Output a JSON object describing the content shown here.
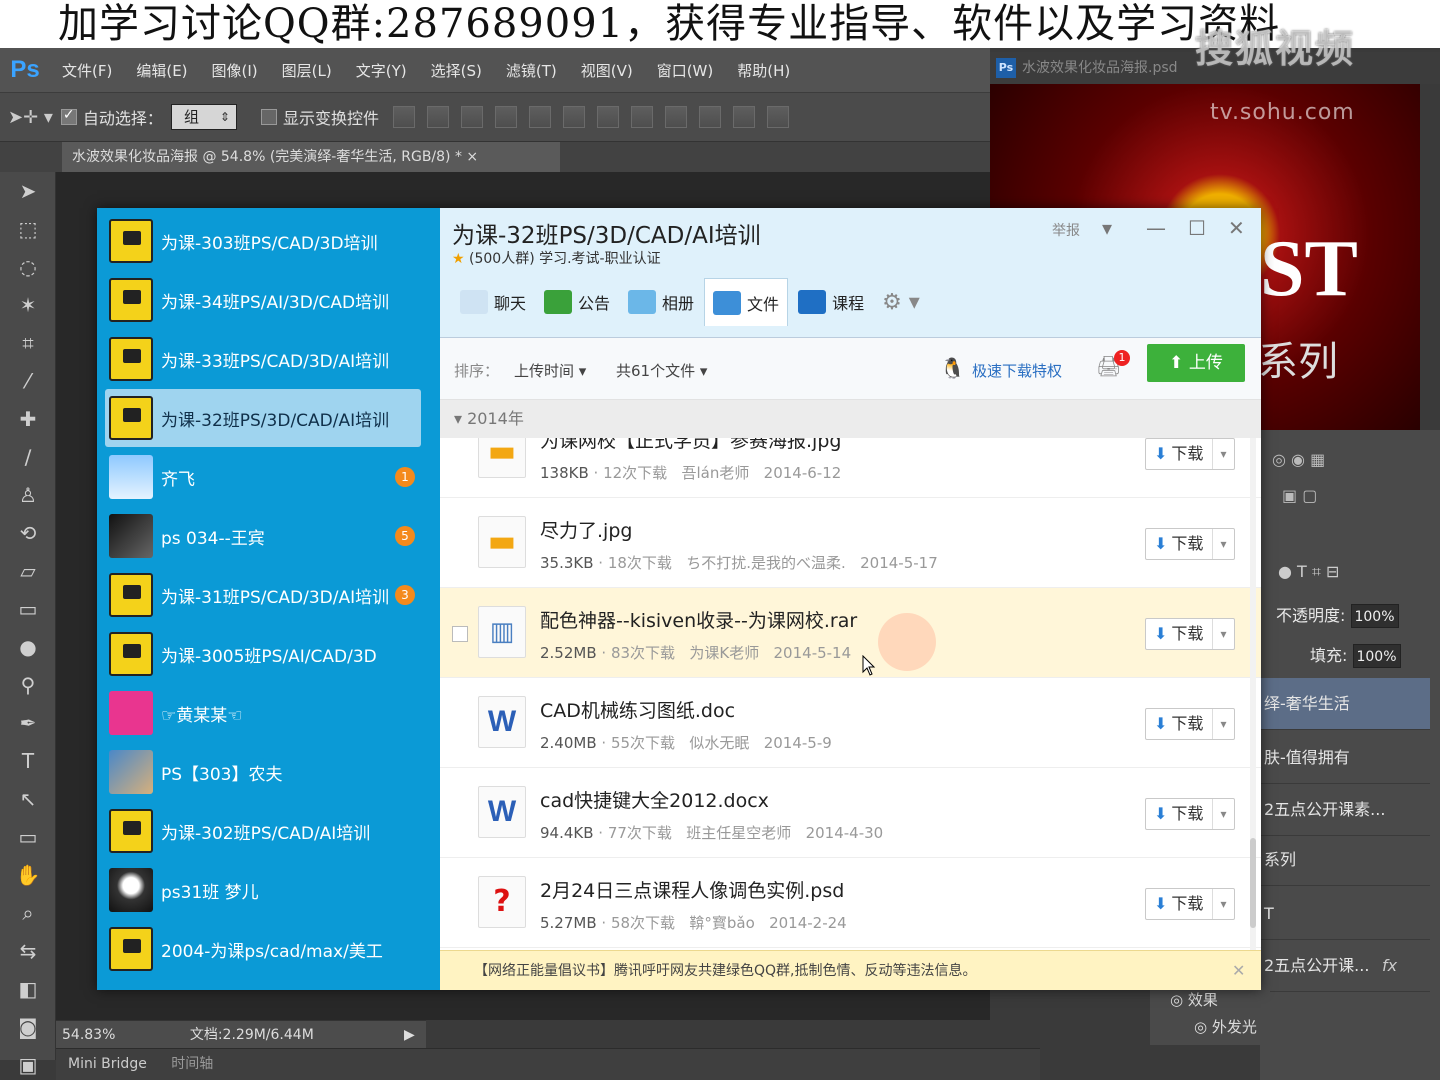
{
  "banner": {
    "text": "加学习讨论QQ群:287689091，获得专业指导、软件以及学习资料"
  },
  "watermark": {
    "brand": "搜狐视频",
    "url": "tv.sohu.com"
  },
  "ps": {
    "logo": "Ps",
    "menu": [
      "文件(F)",
      "编辑(E)",
      "图像(I)",
      "图层(L)",
      "文字(Y)",
      "选择(S)",
      "滤镜(T)",
      "视图(V)",
      "窗口(W)",
      "帮助(H)"
    ],
    "options": {
      "auto_select_label": "自动选择：",
      "auto_select_value": "组",
      "show_transform_label": "显示变换控件"
    },
    "doc_tab": "水波效果化妆品海报 @ 54.8% (完美演绎-奢华生活, RGB/8) * ×",
    "status": {
      "zoom": "54.83%",
      "doc": "文档:2.29M/6.44M"
    },
    "bottom_tabs": {
      "mini_bridge": "Mini Bridge",
      "timeline": "时间轴"
    },
    "preview_title": "水波效果化妆品海报.psd",
    "preview_badge": "Ps",
    "preview_text_main": "ST",
    "preview_text_sub": "系列",
    "panels": {
      "opacity_label": "不透明度:",
      "opacity_value": "100%",
      "fill_label": "填充:",
      "fill_value": "100%",
      "layers": [
        "绎-奢华生活",
        "肤-值得拥有",
        "2五点公开课素...",
        "系列",
        "T",
        "2五点公开课..."
      ],
      "effects_label": "效果",
      "outer_glow_label": "外发光",
      "fx": "fx"
    }
  },
  "qq": {
    "groups": [
      {
        "name": "为课-303班PS/CAD/3D培训",
        "avatar": "logo",
        "badge": ""
      },
      {
        "name": "为课-34班PS/AI/3D/CAD培训",
        "avatar": "logo",
        "badge": ""
      },
      {
        "name": "为课-33班PS/CAD/3D/AI培训",
        "avatar": "logo",
        "badge": ""
      },
      {
        "name": "为课-32班PS/3D/CAD/AI培训",
        "avatar": "logo",
        "badge": "",
        "active": true
      },
      {
        "name": "齐飞",
        "avatar": "sky",
        "badge": "1"
      },
      {
        "name": "ps 034--王宾",
        "avatar": "dark",
        "badge": "5"
      },
      {
        "name": "为课-31班PS/CAD/3D/AI培训",
        "avatar": "logo",
        "badge": "3"
      },
      {
        "name": "为课-3005班PS/AI/CAD/3D",
        "avatar": "logo",
        "badge": ""
      },
      {
        "name": "☞黄某某☜",
        "avatar": "pink",
        "badge": ""
      },
      {
        "name": "PS【303】农夫",
        "avatar": "photo",
        "badge": ""
      },
      {
        "name": "为课-302班PS/CAD/AI培训",
        "avatar": "logo",
        "badge": ""
      },
      {
        "name": "ps31班 梦儿",
        "avatar": "bw",
        "badge": ""
      },
      {
        "name": "2004-为课ps/cad/max/美工",
        "avatar": "logo",
        "badge": ""
      }
    ],
    "title": "为课-32班PS/3D/CAD/AI培训",
    "subtitle": "(500人群) 学习.考试-职业认证",
    "report": "举报",
    "tabs": [
      {
        "label": "聊天",
        "color": "#cfe3f3"
      },
      {
        "label": "公告",
        "color": "#3aa13a"
      },
      {
        "label": "相册",
        "color": "#6bb7e8"
      },
      {
        "label": "文件",
        "color": "#3d8fd8",
        "active": true
      },
      {
        "label": "课程",
        "color": "#1f6fc4"
      }
    ],
    "sort_label": "排序：",
    "sort_value": "上传时间",
    "file_count": "共61个文件",
    "vip_link": "极速下载特权",
    "inbox_badge": "1",
    "upload_label": "上传",
    "year": "2014年",
    "download_label": "下载",
    "files": [
      {
        "name": "为课网校【正式学员】参赛海报.jpg",
        "type": "img",
        "size": "138KB",
        "downloads": "12次下载",
        "uploader": "吾lán老师",
        "date": "2014-6-12"
      },
      {
        "name": "尽力了.jpg",
        "type": "img",
        "size": "35.3KB",
        "downloads": "18次下载",
        "uploader": "ち不打扰.是我的べ温柔.",
        "date": "2014-5-17"
      },
      {
        "name": "配色神器--kisiven收录--为课网校.rar",
        "type": "zip",
        "size": "2.52MB",
        "downloads": "83次下载",
        "uploader": "为课K老师",
        "date": "2014-5-14",
        "hover": true
      },
      {
        "name": "CAD机械练习图纸.doc",
        "type": "word",
        "size": "2.40MB",
        "downloads": "55次下载",
        "uploader": "似水无眠",
        "date": "2014-5-9"
      },
      {
        "name": "cad快捷键大全2012.docx",
        "type": "word",
        "size": "94.4KB",
        "downloads": "77次下载",
        "uploader": "班主任星空老师",
        "date": "2014-4-30"
      },
      {
        "name": "2月24日三点课程人像调色实例.psd",
        "type": "unknown",
        "size": "5.27MB",
        "downloads": "58次下载",
        "uploader": "鞥°寳bǎo",
        "date": "2014-2-24"
      }
    ],
    "notice": "【网络正能量倡议书】腾讯呼吁网友共建绿色QQ群,抵制色情、反动等违法信息。"
  }
}
